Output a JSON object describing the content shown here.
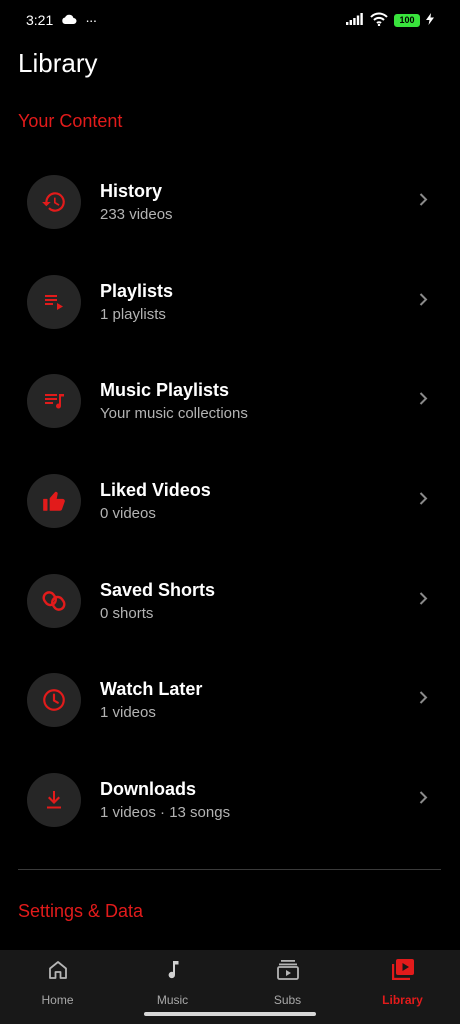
{
  "status_bar": {
    "time": "3:21",
    "more": "···",
    "battery": "100"
  },
  "page": {
    "title": "Library"
  },
  "sections": {
    "content_title": "Your Content",
    "settings_title": "Settings & Data"
  },
  "items": [
    {
      "key": "history",
      "label": "History",
      "sub": "233 videos",
      "icon": "history-icon"
    },
    {
      "key": "playlists",
      "label": "Playlists",
      "sub": "1 playlists",
      "icon": "playlist-play-icon"
    },
    {
      "key": "music-playlists",
      "label": "Music Playlists",
      "sub": "Your music collections",
      "icon": "music-playlist-icon"
    },
    {
      "key": "liked-videos",
      "label": "Liked Videos",
      "sub": "0 videos",
      "icon": "thumbs-up-icon"
    },
    {
      "key": "saved-shorts",
      "label": "Saved Shorts",
      "sub": "0 shorts",
      "icon": "shorts-icon"
    },
    {
      "key": "watch-later",
      "label": "Watch Later",
      "sub": "1 videos",
      "icon": "clock-icon"
    },
    {
      "key": "downloads",
      "label": "Downloads",
      "sub": "1 videos · 13 songs",
      "icon": "download-icon"
    }
  ],
  "nav": [
    {
      "label": "Home",
      "icon": "home-icon",
      "active": false
    },
    {
      "label": "Music",
      "icon": "music-note-icon",
      "active": false
    },
    {
      "label": "Subs",
      "icon": "subscriptions-icon",
      "active": false
    },
    {
      "label": "Library",
      "icon": "library-icon",
      "active": true
    }
  ],
  "colors": {
    "accent": "#e21b1b",
    "background": "#000000",
    "icon_bg": "#262626",
    "nav_bg": "#181818"
  }
}
